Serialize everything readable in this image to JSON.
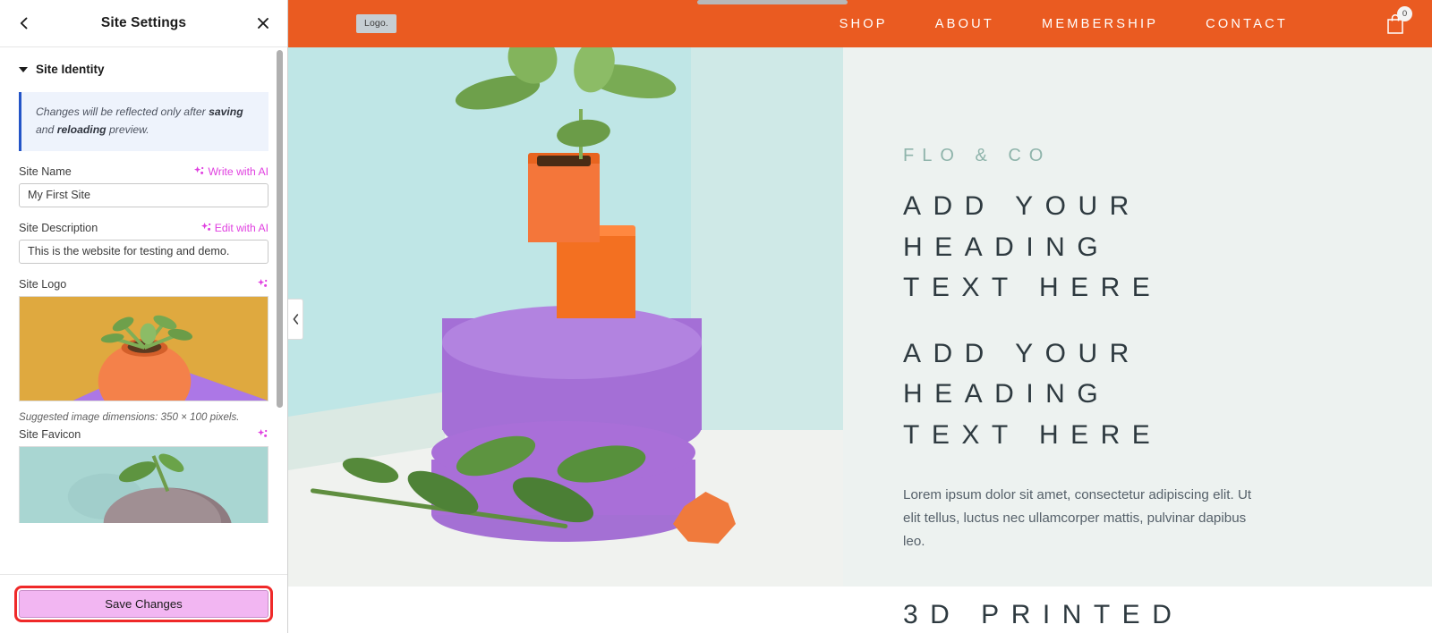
{
  "panel": {
    "title": "Site Settings",
    "back_icon": "chevron-left-icon",
    "close_icon": "close-icon",
    "section": {
      "title": "Site Identity",
      "expanded": true
    },
    "notice": {
      "text_1": "Changes will be reflected only after ",
      "bold_1": "saving",
      "text_2": " and ",
      "bold_2": "reloading",
      "text_3": " preview.",
      "accent_color": "#2354c7",
      "background": "#eef3fc"
    },
    "fields": {
      "site_name": {
        "label": "Site Name",
        "value": "My First Site",
        "placeholder": "My First Site",
        "ai_action": "Write with AI"
      },
      "site_description": {
        "label": "Site Description",
        "value": "This is the website for testing and demo.",
        "placeholder": "This is the website for testing and demo.",
        "ai_action": "Edit with AI"
      },
      "site_logo": {
        "label": "Site Logo",
        "hint": "Suggested image dimensions: 350 × 100 pixels."
      },
      "site_favicon": {
        "label": "Site Favicon"
      }
    },
    "ai_icon": "sparkle-ai-icon",
    "ai_color": "#e040e0",
    "save_label": "Save Changes",
    "save_button_color": "#f2b6f2",
    "save_highlight_color": "#ef2929",
    "collapse_icon": "chevron-left-icon"
  },
  "preview": {
    "nav": {
      "logo_text": "Logo.",
      "background": "#ea5b21",
      "items": [
        {
          "label": "SHOP"
        },
        {
          "label": "ABOUT"
        },
        {
          "label": "MEMBERSHIP"
        },
        {
          "label": "CONTACT"
        }
      ],
      "cart_icon": "shopping-bag-icon",
      "cart_count": "0"
    },
    "hero": {
      "eyebrow": "FLO & CO",
      "eyebrow_color": "#8fb4ab",
      "heading_1_lines": [
        "ADD YOUR",
        "HEADING",
        "TEXT HERE"
      ],
      "heading_2_lines": [
        "ADD YOUR",
        "HEADING",
        "TEXT HERE"
      ],
      "paragraph": "Lorem ipsum dolor sit amet, consectetur adipiscing elit. Ut elit tellus, luctus nec ullamcorper mattis, pulvinar dapibus leo.",
      "bottom_heading": "3D PRINTED",
      "background": "#edf2f0",
      "text_color": "#2e3a40",
      "image_alt": "jade-plant-in-orange-cube-pot-on-purple-podium"
    }
  }
}
